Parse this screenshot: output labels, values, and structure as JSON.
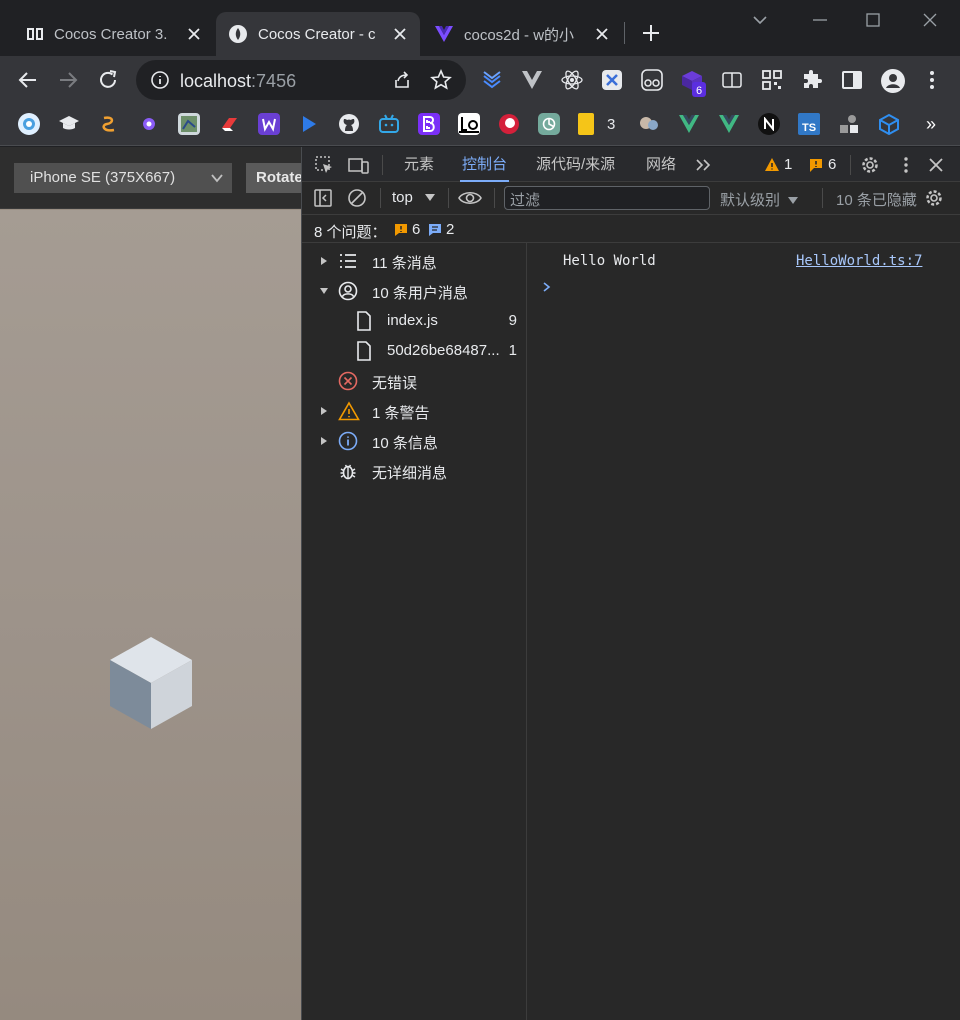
{
  "tabs": [
    {
      "title": "Cocos Creator 3.",
      "icon": "cocos-doc-icon"
    },
    {
      "title": "Cocos Creator - c",
      "icon": "cocos-icon",
      "active": true
    },
    {
      "title": "cocos2d - w的小",
      "icon": "vue-icon"
    }
  ],
  "toolbar": {
    "url_host": "localhost",
    "url_port": ":7456"
  },
  "bookmarks": {
    "count_badge": "3",
    "ext_badge": "6",
    "items": [
      "TS"
    ]
  },
  "device": {
    "selected": "iPhone SE (375X667)",
    "rotate_label": "Rotate"
  },
  "devtools": {
    "tabs": [
      "元素",
      "控制台",
      "源代码/来源",
      "网络"
    ],
    "active_tab": "控制台",
    "warn_count": "1",
    "issue_count": "6",
    "context": "top",
    "filter_placeholder": "过滤",
    "levels": "默认级别",
    "hidden": "10 条已隐藏",
    "issues_label": "8 个问题：",
    "issues_warn": "6",
    "issues_info": "2",
    "sidebar": [
      {
        "label": "11 条消息"
      },
      {
        "label": "10 条用户消息"
      },
      {
        "label": "index.js",
        "count": "9"
      },
      {
        "label": "50d26be68487...",
        "count": "1"
      },
      {
        "label": "无错误"
      },
      {
        "label": "1 条警告"
      },
      {
        "label": "10 条信息"
      },
      {
        "label": "无详细消息"
      }
    ],
    "console": {
      "message": "Hello World",
      "source": "HelloWorld.ts:7"
    }
  }
}
